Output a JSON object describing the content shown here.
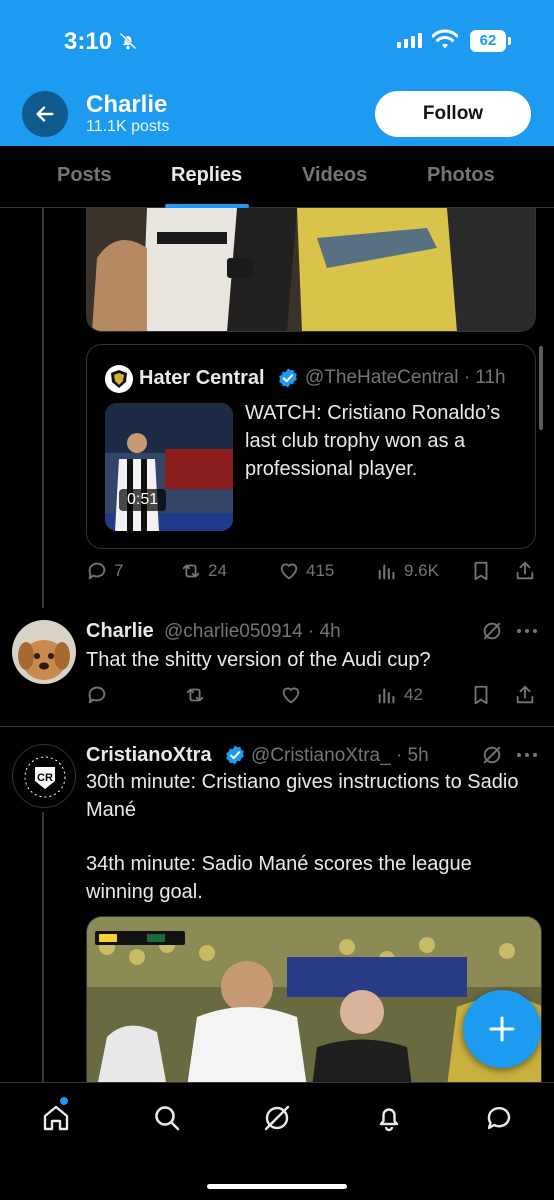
{
  "status_bar": {
    "time": "3:10",
    "battery": "62"
  },
  "header": {
    "name": "Charlie",
    "posts": "11.1K posts",
    "follow_label": "Follow"
  },
  "tabs": [
    {
      "label": "Posts"
    },
    {
      "label": "Replies"
    },
    {
      "label": "Videos"
    },
    {
      "label": "Photos"
    }
  ],
  "active_tab": "Replies",
  "quoted_post": {
    "name": "Hater Central",
    "handle_time": "@TheHateCentral · 11h",
    "text": "WATCH: Cristiano Ronaldo’s last club trophy won as a professional player.",
    "video_duration": "0:51"
  },
  "post1_actions": {
    "replies": "7",
    "reposts": "24",
    "likes": "415",
    "views": "9.6K"
  },
  "reply": {
    "name": "Charlie",
    "handle_time": "@charlie050914 · 4h",
    "text": "That the shitty version of the Audi cup?",
    "views": "42"
  },
  "post3": {
    "name": "CristianoXtra",
    "handle_time": "@CristianoXtra_ · 5h",
    "text_line1": "30th minute: Cristiano gives instructions to Sadio Mané",
    "text_line2": "34th minute: Sadio Mané scores the league winning goal.",
    "avatar_text": "CR"
  },
  "colors": {
    "accent": "#1d9bf0",
    "background": "#000000",
    "muted": "#71767b",
    "text": "#e7e9ea"
  },
  "icons": {
    "bottom_nav": [
      "home-icon",
      "search-icon",
      "grok-icon",
      "notifications-icon",
      "messages-icon"
    ]
  }
}
